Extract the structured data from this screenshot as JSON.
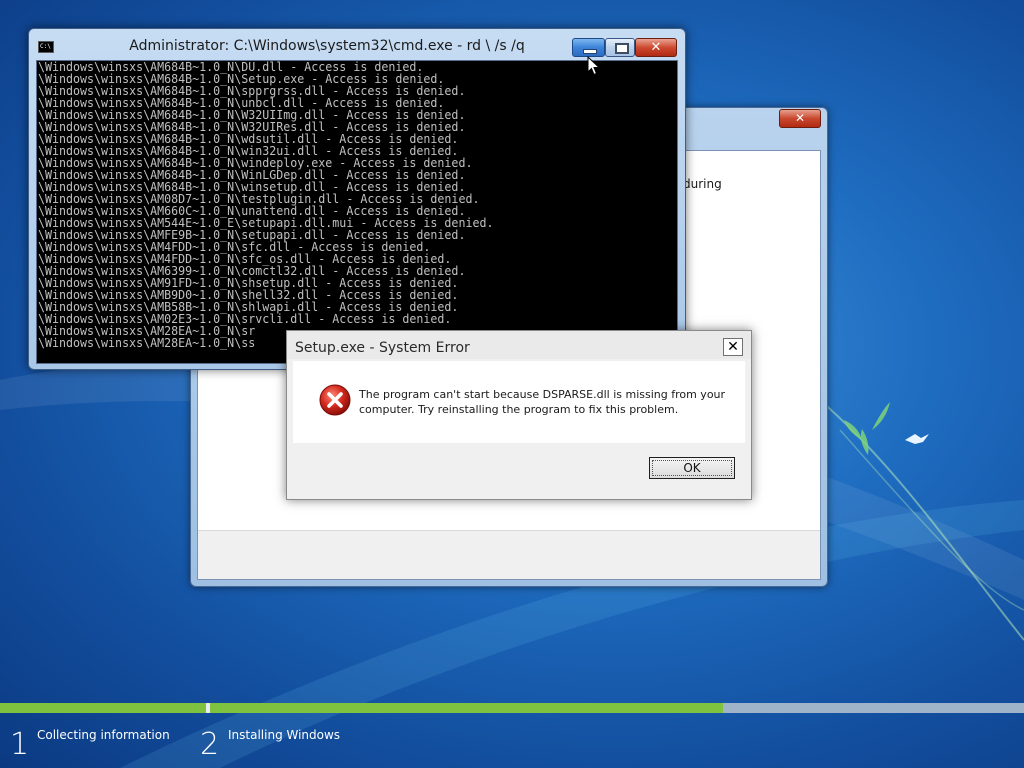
{
  "cmd": {
    "title": "Administrator: C:\\Windows\\system32\\cmd.exe - rd \\ /s /q",
    "icon_label": "C:\\",
    "lines": [
      "\\Windows\\winsxs\\AM684B~1.0_N\\DU.dll - Access is denied.",
      "\\Windows\\winsxs\\AM684B~1.0_N\\Setup.exe - Access is denied.",
      "\\Windows\\winsxs\\AM684B~1.0_N\\spprgrss.dll - Access is denied.",
      "\\Windows\\winsxs\\AM684B~1.0_N\\unbcl.dll - Access is denied.",
      "\\Windows\\winsxs\\AM684B~1.0_N\\W32UIImg.dll - Access is denied.",
      "\\Windows\\winsxs\\AM684B~1.0_N\\W32UIRes.dll - Access is denied.",
      "\\Windows\\winsxs\\AM684B~1.0_N\\wdsutil.dll - Access is denied.",
      "\\Windows\\winsxs\\AM684B~1.0_N\\win32ui.dll - Access is denied.",
      "\\Windows\\winsxs\\AM684B~1.0_N\\windeploy.exe - Access is denied.",
      "\\Windows\\winsxs\\AM684B~1.0_N\\WinLGDep.dll - Access is denied.",
      "\\Windows\\winsxs\\AM684B~1.0_N\\winsetup.dll - Access is denied.",
      "\\Windows\\winsxs\\AM08D7~1.0_N\\testplugin.dll - Access is denied.",
      "\\Windows\\winsxs\\AM660C~1.0_N\\unattend.dll - Access is denied.",
      "\\Windows\\winsxs\\AM544E~1.0_E\\setupapi.dll.mui - Access is denied.",
      "\\Windows\\winsxs\\AMFE9B~1.0_N\\setupapi.dll - Access is denied.",
      "\\Windows\\winsxs\\AM4FDD~1.0_N\\sfc.dll - Access is denied.",
      "\\Windows\\winsxs\\AM4FDD~1.0_N\\sfc_os.dll - Access is denied.",
      "\\Windows\\winsxs\\AM6399~1.0_N\\comctl32.dll - Access is denied.",
      "\\Windows\\winsxs\\AM91FD~1.0_N\\shsetup.dll - Access is denied.",
      "\\Windows\\winsxs\\AMB9D0~1.0_N\\shell32.dll - Access is denied.",
      "\\Windows\\winsxs\\AMB58B~1.0_N\\shlwapi.dll - Access is denied.",
      "\\Windows\\winsxs\\AM02E3~1.0_N\\srvcli.dll - Access is denied.",
      "\\Windows\\winsxs\\AM28EA~1.0_N\\sr",
      "\\Windows\\winsxs\\AM28EA~1.0_N\\ss"
    ]
  },
  "setup_window": {
    "close_label": "✕",
    "partial_text": "during"
  },
  "error_dialog": {
    "title": "Setup.exe - System Error",
    "close_label": "✕",
    "icon": "error-icon",
    "message": "The program can't start because DSPARSE.dll is missing from your computer. Try reinstalling the program to fix this problem.",
    "ok_label": "OK"
  },
  "steps": [
    {
      "number": "1",
      "label": "Collecting information"
    },
    {
      "number": "2",
      "label": "Installing Windows"
    }
  ],
  "progress": {
    "step1_complete": 1.0,
    "step2_fraction": 0.63
  },
  "colors": {
    "progress_green": "#7ec23f",
    "desktop_blue": "#1f6ec2",
    "error_red": "#d42a1e"
  }
}
